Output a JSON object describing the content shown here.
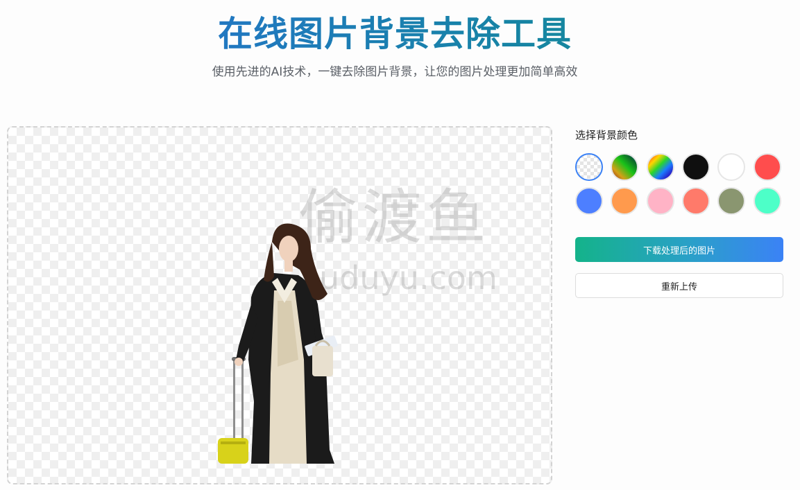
{
  "header": {
    "title": "在线图片背景去除工具",
    "subtitle": "使用先进的AI技术，一键去除图片背景，让您的图片处理更加简单高效"
  },
  "canvas": {
    "watermark_cn": "偷渡鱼",
    "watermark_en": "uduyu.com"
  },
  "panel": {
    "bg_label": "选择背景颜色",
    "swatches": [
      {
        "name": "transparent",
        "color": "transparent",
        "selected": true
      },
      {
        "name": "gradient-1",
        "color": "gradient"
      },
      {
        "name": "gradient-2",
        "color": "rainbow"
      },
      {
        "name": "black",
        "color": "#0f0f0f"
      },
      {
        "name": "white",
        "color": "#ffffff"
      },
      {
        "name": "red",
        "color": "#ff4d4d"
      },
      {
        "name": "blue",
        "color": "#4d7fff"
      },
      {
        "name": "orange",
        "color": "#ff9a4d"
      },
      {
        "name": "pink",
        "color": "#ffb3c6"
      },
      {
        "name": "salmon",
        "color": "#ff7a6a"
      },
      {
        "name": "olive",
        "color": "#8a9670"
      },
      {
        "name": "mint",
        "color": "#4dffc8"
      }
    ],
    "download_label": "下载处理后的图片",
    "reupload_label": "重新上传"
  }
}
